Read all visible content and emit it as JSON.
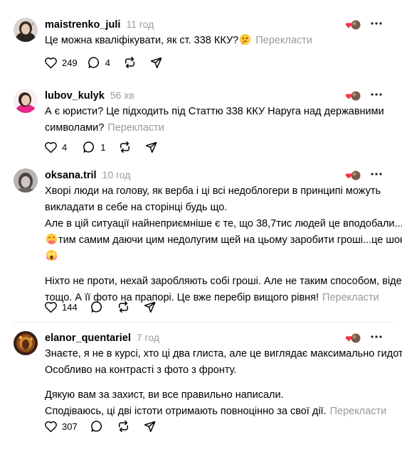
{
  "translate_label": "Перекласти",
  "posts": [
    {
      "username": "maistrenko_juli",
      "time": "11 год",
      "paragraphs": [
        [
          "Це можна кваліфікувати, як ст. 338 ККУ?"
        ]
      ],
      "likes": "249",
      "replies": "4"
    },
    {
      "username": "lubov_kulyk",
      "time": "56 хв",
      "paragraphs": [
        [
          "А є юристи? Це підходить під Статтю 338 ККУ Наруга над державними",
          "символами?"
        ]
      ],
      "likes": "4",
      "replies": "1"
    },
    {
      "username": "oksana.tril",
      "time": "10 год",
      "paragraphs": [
        [
          "Хворі люди на голову, як верба і ці всі недоблогери в принципі можуть",
          "викладати в себе на сторінці будь що.",
          "Але в цій ситуації найнеприємніше є те, що 38,7тис людей це вподобали...",
          "тим самим даючи цим недолугим щей на цьому заробити гроші...це шок",
          ""
        ],
        [
          "Ніхто не проти, нехай заробляють собі гроші. Але не таким способом, відео",
          "тощо. А її фото на прапорі. Це вже перебір вищого рівня!"
        ]
      ],
      "likes": "144",
      "replies": ""
    },
    {
      "username": "elanor_quentariel",
      "time": "7 год",
      "paragraphs": [
        [
          "Знаєте, я не в курсі, хто ці два глиста, але це виглядає максимально гидотно.",
          "Особливо на контрасті з фото з фронту."
        ],
        [
          "Дякую вам за захист, ви все правильно написали.",
          "Сподіваюсь, ці дві істоти отримають повноцінно за свої дії."
        ]
      ],
      "likes": "307",
      "replies": ""
    }
  ]
}
